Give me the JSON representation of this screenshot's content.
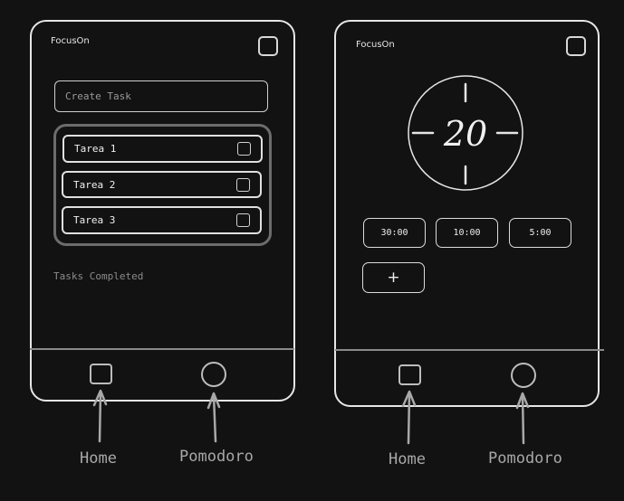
{
  "screens": {
    "tasks": {
      "app_title": "FocusOn",
      "create_task_placeholder": "Create Task",
      "tasks": [
        {
          "label": "Tarea 1"
        },
        {
          "label": "Tarea 2"
        },
        {
          "label": "Tarea 3"
        }
      ],
      "tasks_completed_label": "Tasks Completed"
    },
    "pomodoro": {
      "app_title": "FocusOn",
      "timer_value": "20",
      "presets": [
        "30:00",
        "10:00",
        "5:00"
      ],
      "add_button": "+"
    }
  },
  "captions": {
    "left_home": "Home",
    "left_pomodoro": "Pomodoro",
    "right_home": "Home",
    "right_pomodoro": "Pomodoro"
  },
  "colors": {
    "background": "#121212",
    "stroke": "#e6e6e6",
    "caption": "#a8a8a8"
  }
}
